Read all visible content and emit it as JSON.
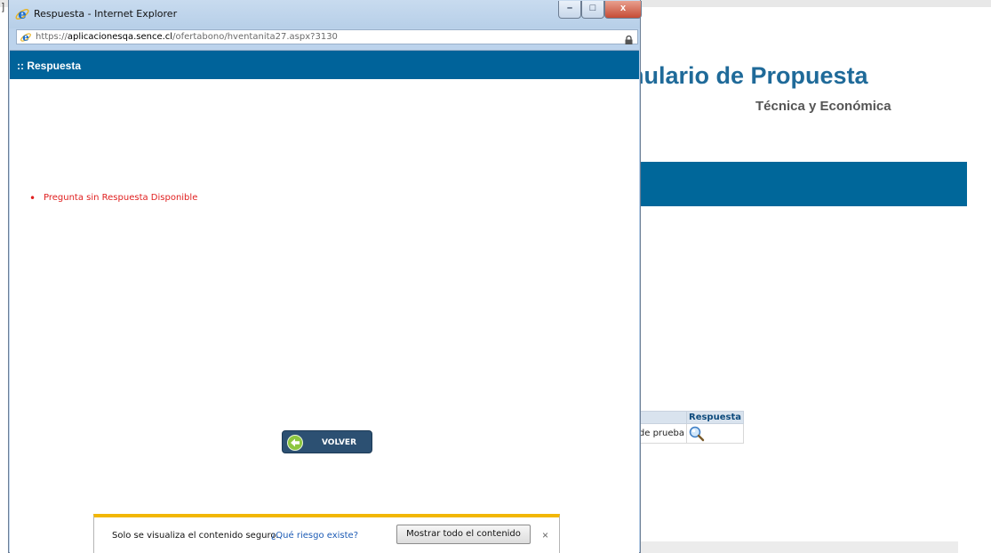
{
  "background_page": {
    "left_stub": "]",
    "title_fragment": "rmulario de Propuesta",
    "subtitle": "Técnica y Económica",
    "table": {
      "header_respuesta": "Respuesta",
      "row_first_cell": "de prueba"
    }
  },
  "popup": {
    "window_title": "Respuesta - Internet Explorer",
    "address": {
      "scheme": "https://",
      "domain": "aplicacionesqa.sence.cl",
      "path": "/ofertabono/hventanita27.aspx?3130"
    },
    "header_text": ":: Respuesta",
    "errors": [
      "Pregunta sin Respuesta Disponible"
    ],
    "volver_label": "VOLVER",
    "notification": {
      "message": "Solo se visualiza el contenido seguro.",
      "link": "¿Qué riesgo existe?",
      "button": "Mostrar todo el contenido",
      "close": "×"
    },
    "window_controls": {
      "minimize": "–",
      "maximize": "□",
      "close": "x"
    }
  },
  "colors": {
    "brand_blue": "#00639a",
    "title_blue": "#1f6a99",
    "error_red": "#e02020",
    "notify_bar": "#f2b705"
  },
  "icons": [
    "ie-logo-icon",
    "lock-icon",
    "back-arrow-icon",
    "magnifier-icon"
  ]
}
